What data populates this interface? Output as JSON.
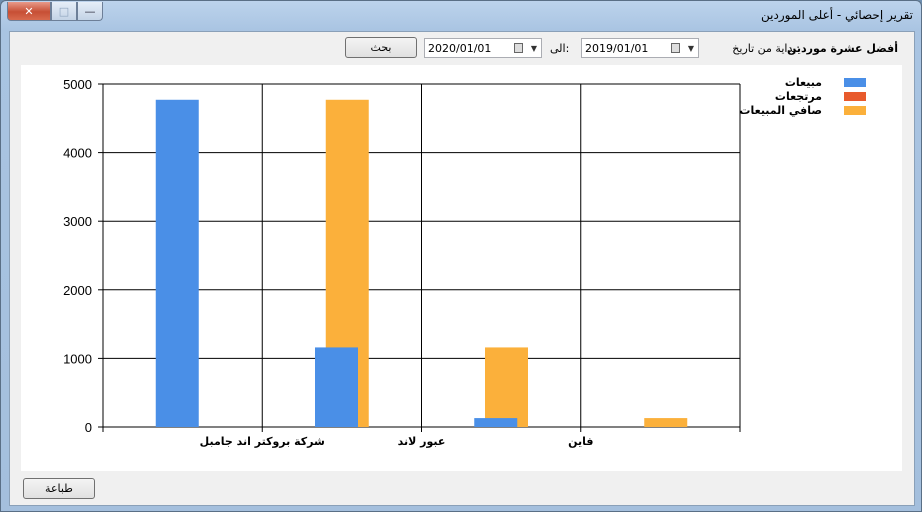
{
  "window": {
    "title": "تقرير إحصائي - أعلى الموردين"
  },
  "caption_buttons": {
    "close": "✕",
    "maximize": "□",
    "minimize": "—"
  },
  "filters": {
    "heading": "أفضل عشرة موردين",
    "from_label": "بداية من تاريخ:",
    "from_value": "2019/01/01",
    "to_label": "الى:",
    "to_value": "2020/01/01",
    "search_label": "بحث"
  },
  "footer": {
    "print_label": "طباعة"
  },
  "colors": {
    "sales": "#4a8fe7",
    "returns": "#e85a2c",
    "net_sales": "#fbb03b"
  },
  "chart_data": {
    "type": "bar",
    "categories": [
      "شركة بروكتر اند جامبل",
      "عبور لاند",
      "فاين"
    ],
    "series": [
      {
        "name": "مبيعات",
        "values": [
          4770,
          1160,
          130
        ]
      },
      {
        "name": "مرتجعات",
        "values": [
          0,
          0,
          0
        ]
      },
      {
        "name": "صافي المبيعات",
        "values": [
          4770,
          1160,
          130
        ]
      }
    ],
    "ylim": [
      0,
      5000
    ],
    "yticks": [
      0,
      1000,
      2000,
      3000,
      4000,
      5000
    ],
    "grid": true,
    "legend_position": "top-right"
  }
}
